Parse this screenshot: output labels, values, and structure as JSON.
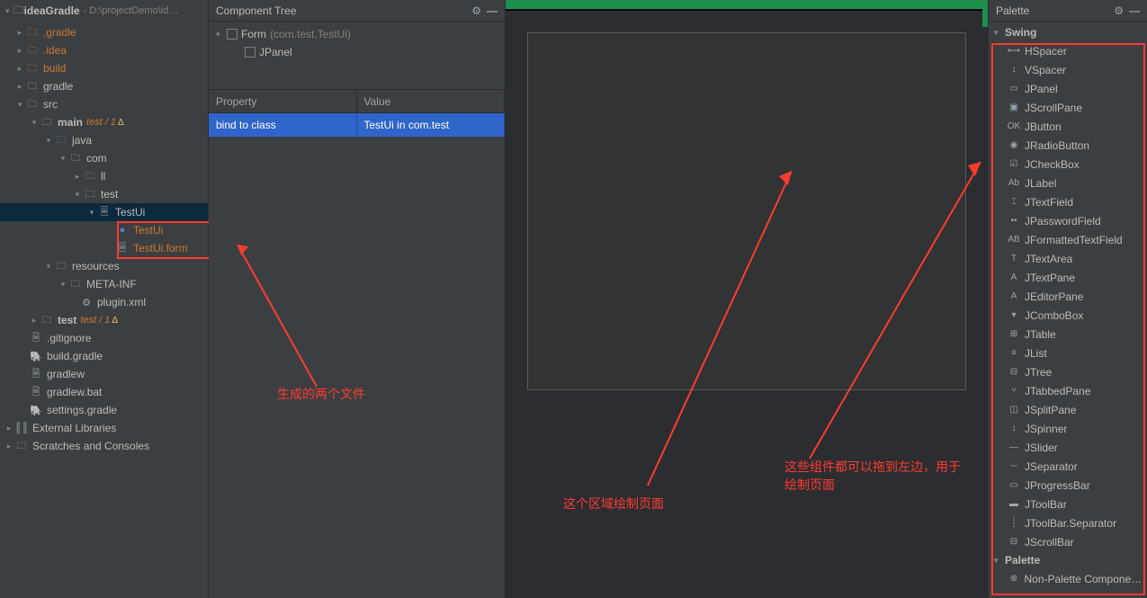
{
  "project": {
    "title": "ideaGradle",
    "path": "- D:\\projectDemo\\id…",
    "nodes": {
      "n0": {
        "label": ".gradle",
        "style": "orange"
      },
      "n1": {
        "label": ".idea",
        "style": "orange"
      },
      "n2": {
        "label": "build",
        "style": "orange"
      },
      "n3": {
        "label": "gradle"
      },
      "n4": {
        "label": "src"
      },
      "n5": {
        "label": "main",
        "suffix": "test / 1",
        "warn": "Δ"
      },
      "n6": {
        "label": "java"
      },
      "n7": {
        "label": "com"
      },
      "n8": {
        "label": "ll"
      },
      "n9": {
        "label": "test"
      },
      "n10": {
        "label": "TestUi"
      },
      "n11": {
        "label": "TestUi",
        "style": "orange"
      },
      "n12": {
        "label": "TestUi.form",
        "style": "orange"
      },
      "n13": {
        "label": "resources"
      },
      "n14": {
        "label": "META-INF"
      },
      "n15": {
        "label": "plugin.xml"
      },
      "n16": {
        "label": "test",
        "suffix": "test / 1",
        "warn": "Δ"
      },
      "n17": {
        "label": ".gitignore"
      },
      "n18": {
        "label": "build.gradle"
      },
      "n19": {
        "label": "gradlew"
      },
      "n20": {
        "label": "gradlew.bat"
      },
      "n21": {
        "label": "settings.gradle"
      },
      "n22": {
        "label": "External Libraries"
      },
      "n23": {
        "label": "Scratches and Consoles"
      }
    }
  },
  "componentTree": {
    "title": "Component Tree",
    "form": {
      "label": "Form",
      "hint": "(com.test.TestUi)"
    },
    "jpanel": {
      "label": "JPanel"
    },
    "propertyHeader": {
      "col1": "Property",
      "col2": "Value"
    },
    "propertyRow": {
      "key": "bind to class",
      "value": "TestUi in com.test"
    }
  },
  "palette": {
    "title": "Palette",
    "groupSwing": "Swing",
    "groupPalette": "Palette",
    "items": [
      {
        "icon": "⟷",
        "label": "HSpacer"
      },
      {
        "icon": "↕",
        "label": "VSpacer"
      },
      {
        "icon": "▭",
        "label": "JPanel"
      },
      {
        "icon": "▣",
        "label": "JScrollPane"
      },
      {
        "icon": "OK",
        "label": "JButton"
      },
      {
        "icon": "◉",
        "label": "JRadioButton"
      },
      {
        "icon": "☑",
        "label": "JCheckBox"
      },
      {
        "icon": "Ab",
        "label": "JLabel"
      },
      {
        "icon": "⌶",
        "label": "JTextField"
      },
      {
        "icon": "••",
        "label": "JPasswordField"
      },
      {
        "icon": "AB",
        "label": "JFormattedTextField"
      },
      {
        "icon": "T",
        "label": "JTextArea"
      },
      {
        "icon": "A",
        "label": "JTextPane"
      },
      {
        "icon": "A",
        "label": "JEditorPane"
      },
      {
        "icon": "▾",
        "label": "JComboBox"
      },
      {
        "icon": "⊞",
        "label": "JTable"
      },
      {
        "icon": "≡",
        "label": "JList"
      },
      {
        "icon": "⊟",
        "label": "JTree"
      },
      {
        "icon": "⑂",
        "label": "JTabbedPane"
      },
      {
        "icon": "◫",
        "label": "JSplitPane"
      },
      {
        "icon": "↕",
        "label": "JSpinner"
      },
      {
        "icon": "—",
        "label": "JSlider"
      },
      {
        "icon": "─",
        "label": "JSeparator"
      },
      {
        "icon": "▭",
        "label": "JProgressBar"
      },
      {
        "icon": "▬",
        "label": "JToolBar"
      },
      {
        "icon": "┊",
        "label": "JToolBar.Separator"
      },
      {
        "icon": "⊟",
        "label": "JScrollBar"
      }
    ],
    "nonPalette": {
      "icon": "⊕",
      "label": "Non-Palette Component…"
    }
  },
  "annotations": {
    "files": "生成的两个文件",
    "designArea": "这个区域绘制页面",
    "dragHint": "这些组件都可以拖到左边，用于绘制页面"
  },
  "colors": {
    "accentRed": "#ff3b30",
    "selectBlue": "#2f65ca",
    "green": "#1e8f4d"
  }
}
